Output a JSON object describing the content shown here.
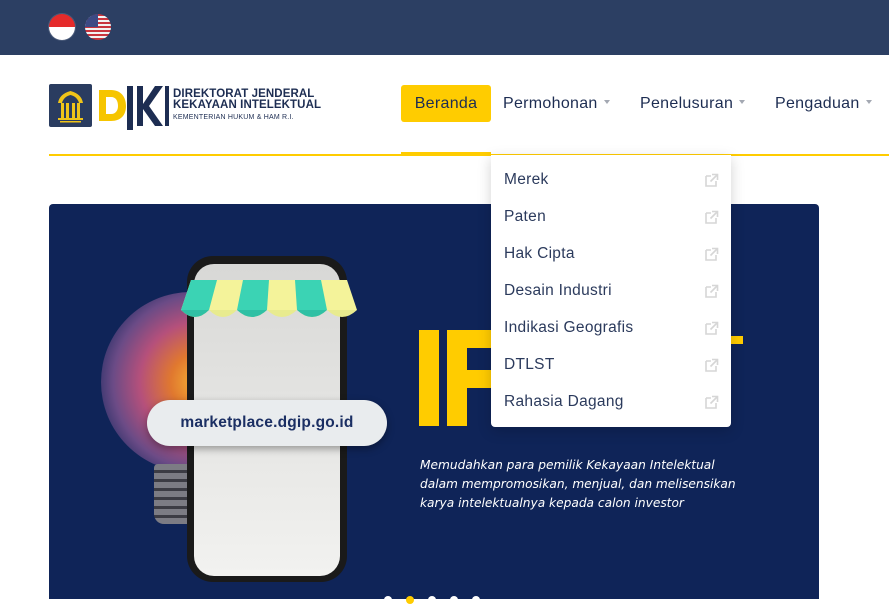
{
  "topbar": {
    "languages": [
      {
        "code": "id",
        "icon": "indonesia-flag-icon"
      },
      {
        "code": "en",
        "icon": "usa-flag-icon"
      }
    ]
  },
  "logo": {
    "emblem_icon": "kemenkumham-emblem-icon",
    "mark": "DJKI",
    "line1": "DIREKTORAT JENDERAL",
    "line2": "KEKAYAAN INTELEKTUAL",
    "line3": "KEMENTERIAN HUKUM & HAM R.I."
  },
  "nav": {
    "items": [
      {
        "label": "Beranda",
        "active": true
      },
      {
        "label": "Permohonan",
        "dropdown": true
      },
      {
        "label": "Penelusuran",
        "dropdown": true
      },
      {
        "label": "Pengaduan",
        "dropdown": true
      }
    ]
  },
  "dropdown": {
    "items": [
      {
        "label": "Merek",
        "icon": "external-link-icon"
      },
      {
        "label": "Paten",
        "icon": "external-link-icon"
      },
      {
        "label": "Hak Cipta",
        "icon": "external-link-icon"
      },
      {
        "label": "Desain Industri",
        "icon": "external-link-icon"
      },
      {
        "label": "Indikasi Geografis",
        "icon": "external-link-icon"
      },
      {
        "label": "DTLST",
        "icon": "external-link-icon"
      },
      {
        "label": "Rahasia Dagang",
        "icon": "external-link-icon"
      }
    ]
  },
  "banner": {
    "url_pill": "marketplace.dgip.go.id",
    "tagline": [
      "Memudahkan para pemilik Kekayaan Intelektual",
      "dalam mempromosikan, menjual, dan melisensikan",
      "karya intelektualnya kepada calon investor"
    ],
    "slide_count": 5,
    "active_slide": 2
  },
  "colors": {
    "topbar": "#2c3f63",
    "accent": "#ffcc00",
    "banner": "#0f2458",
    "text": "#1d2d52"
  }
}
